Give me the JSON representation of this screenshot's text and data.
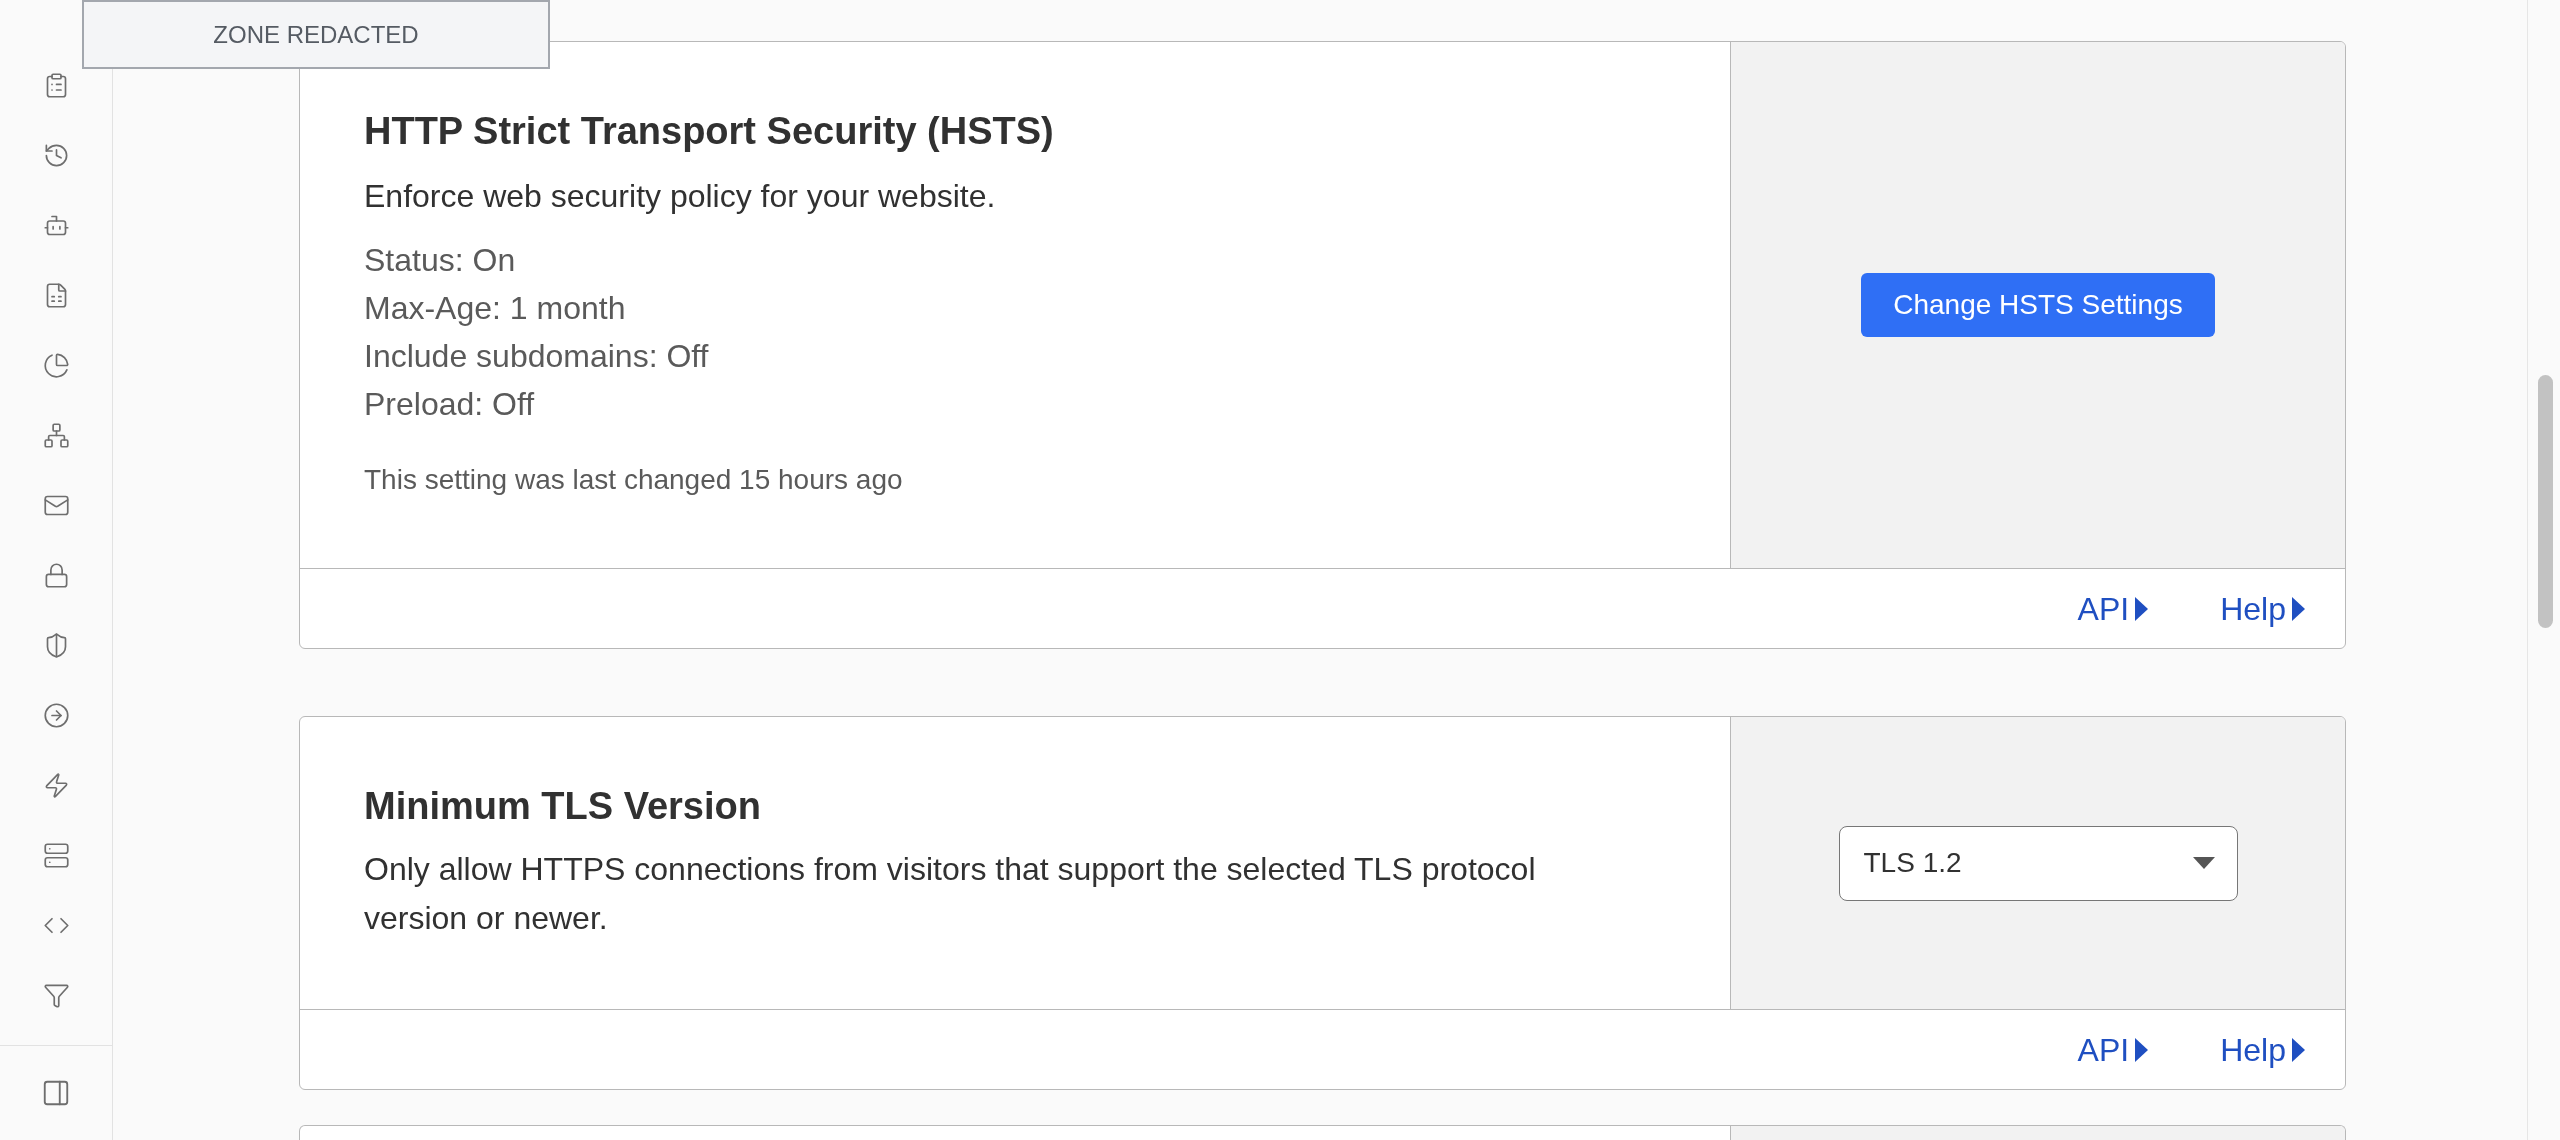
{
  "zone_label": "ZONE REDACTED",
  "cards": [
    {
      "kind": "button",
      "title": "HTTP Strict Transport Security (HSTS)",
      "description": "Enforce web security policy for your website.",
      "details": [
        "Status: On",
        "Max-Age: 1 month",
        "Include subdomains: Off",
        "Preload: Off"
      ],
      "last_changed": "This setting was last changed 15 hours ago",
      "button": "Change HSTS Settings",
      "links": [
        "API",
        "Help"
      ]
    },
    {
      "kind": "select",
      "title": "Minimum TLS Version",
      "description": "Only allow HTTPS connections from visitors that support the selected TLS protocol version or newer.",
      "select_value": "TLS 1.2",
      "links": [
        "API",
        "Help"
      ]
    }
  ]
}
